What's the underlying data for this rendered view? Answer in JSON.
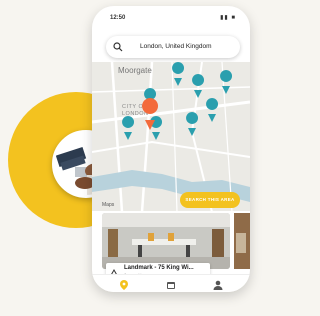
{
  "status": {
    "time": "12:50",
    "icons": "▮▮ ■"
  },
  "search": {
    "location": "London, United Kingdom",
    "icon": "search-icon"
  },
  "map": {
    "labels": {
      "moorgate": "Moorgate",
      "city_of_london": "CITY OF LONDON"
    },
    "maps_attribution": "Maps",
    "search_area_label": "SEARCH THIS AREA"
  },
  "cards": [
    {
      "title": "Landmark - 75 King Wi...",
      "subtitle": "& coworking"
    }
  ],
  "tabs": [
    {
      "icon": "location-pin-icon",
      "active": true
    },
    {
      "icon": "calendar-icon",
      "active": false
    },
    {
      "icon": "profile-icon",
      "active": false
    }
  ],
  "colors": {
    "accent": "#f3c21f",
    "pin": "#2a9fae",
    "pin_selected": "#f36a3b"
  }
}
